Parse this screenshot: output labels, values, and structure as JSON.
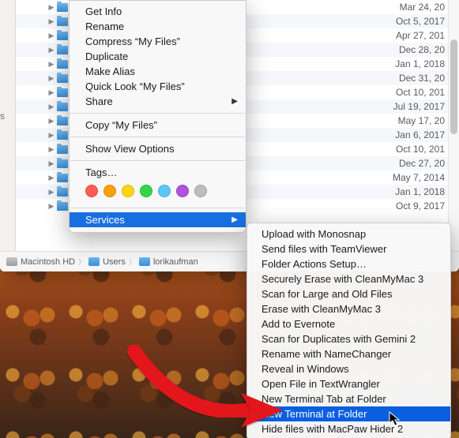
{
  "rows": [
    {
      "date": "Mar 24, 20"
    },
    {
      "date": "Oct 5, 2017"
    },
    {
      "date": "Apr 27, 201"
    },
    {
      "date": "Dec 28, 20"
    },
    {
      "date": "Jan 1, 2018"
    },
    {
      "date": "Dec 31, 20"
    },
    {
      "date": "Oct 10, 201"
    },
    {
      "date": "Jul 19, 2017"
    },
    {
      "date": "May 17, 20"
    },
    {
      "date": "Jan 6, 2017"
    },
    {
      "date": "Oct 10, 201"
    },
    {
      "date": "Dec 27, 20"
    },
    {
      "date": "May 7, 2014"
    },
    {
      "date": "Jan 1, 2018"
    },
    {
      "date": "Oct 9, 2017"
    }
  ],
  "context_menu": {
    "group1": [
      "Get Info",
      "Rename",
      "Compress “My Files”",
      "Duplicate",
      "Make Alias",
      "Quick Look “My Files”"
    ],
    "share": "Share",
    "copy": "Copy “My Files”",
    "show_view": "Show View Options",
    "tags_label": "Tags…",
    "services": "Services"
  },
  "tag_colors": [
    "#ff5d55",
    "#ff9f0a",
    "#ffd60a",
    "#32d74b",
    "#5ac8fa",
    "#af52de",
    "#bdbdbd"
  ],
  "services_menu": [
    "Upload with Monosnap",
    "Send files with TeamViewer",
    "Folder Actions Setup…",
    "Securely Erase with CleanMyMac 3",
    "Scan for Large and Old Files",
    "Erase with CleanMyMac 3",
    "Add to Evernote",
    "Scan for Duplicates with Gemini 2",
    "Rename with NameChanger",
    "Reveal in Windows",
    "Open File in TextWrangler",
    "New Terminal Tab at Folder",
    "New Terminal at Folder",
    "Hide files with MacPaw Hider 2"
  ],
  "services_highlight_index": 12,
  "pathbar": {
    "seg1": "Macintosh HD",
    "seg2": "Users",
    "seg3": "lorikaufman"
  }
}
